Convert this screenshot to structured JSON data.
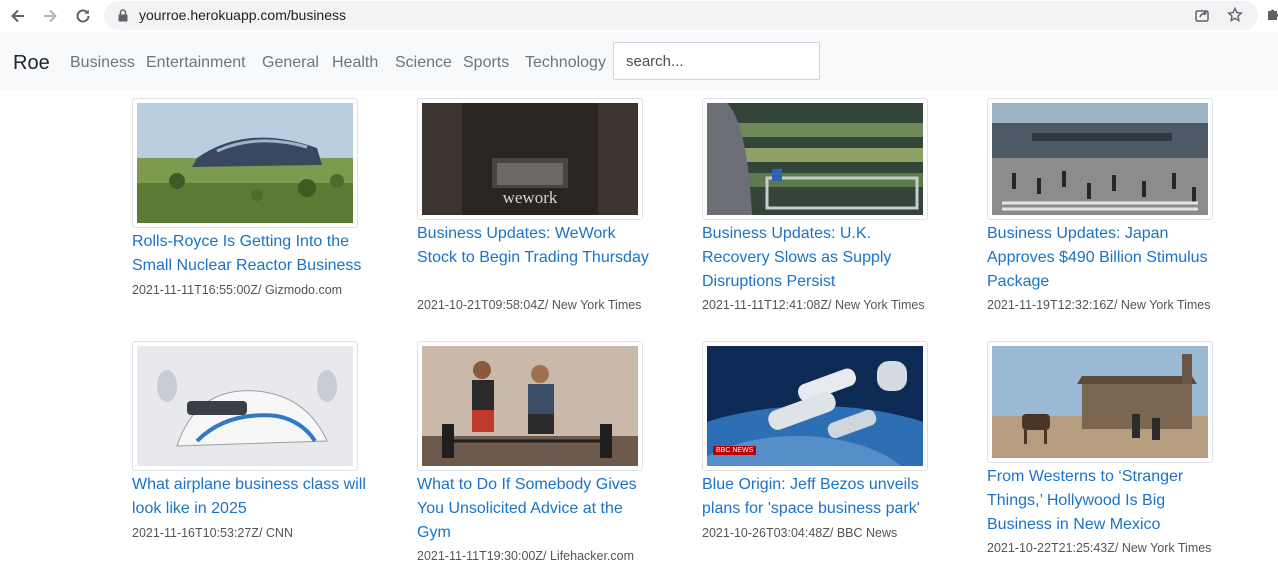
{
  "browser": {
    "url": "yourroe.herokuapp.com/business"
  },
  "navbar": {
    "brand": "Roe",
    "links": [
      "Business",
      "Entertainment",
      "General",
      "Health",
      "Science",
      "Sports",
      "Technology"
    ],
    "search_placeholder": "search..."
  },
  "articles": [
    {
      "title": "Rolls-Royce Is Getting Into the Small Nuclear Reactor Business",
      "meta": "2021-11-11T16:55:00Z/ Gizmodo.com",
      "image": "stadium-rendering"
    },
    {
      "title": "Business Updates: WeWork Stock to Begin Trading Thursday",
      "meta": "2021-10-21T09:58:04Z/ New York Times",
      "image": "wework-sign"
    },
    {
      "title": "Business Updates: U.K. Recovery Slows as Supply Disruptions Persist",
      "meta": "2021-11-11T12:41:08Z/ New York Times",
      "image": "grocery-shopper"
    },
    {
      "title": "Business Updates: Japan Approves $490 Billion Stimulus Package",
      "meta": "2021-11-19T12:32:16Z/ New York Times",
      "image": "tokyo-crossing"
    },
    {
      "title": "What airplane business class will look like in 2025",
      "meta": "2021-11-16T10:53:27Z/ CNN",
      "image": "airplane-seat"
    },
    {
      "title": "What to Do If Somebody Gives You Unsolicited Advice at the Gym",
      "meta": "2021-11-11T19:30:00Z/ Lifehacker.com",
      "image": "gym-deadlift"
    },
    {
      "title": "Blue Origin: Jeff Bezos unveils plans for 'space business park'",
      "meta": "2021-10-26T03:04:48Z/ BBC News",
      "image": "space-station",
      "badge": "BBC NEWS"
    },
    {
      "title": "From Westerns to ‘Stranger Things,’ Hollywood Is Big Business in New Mexico",
      "meta": "2021-10-22T21:25:43Z/ New York Times",
      "image": "film-set-western"
    }
  ]
}
